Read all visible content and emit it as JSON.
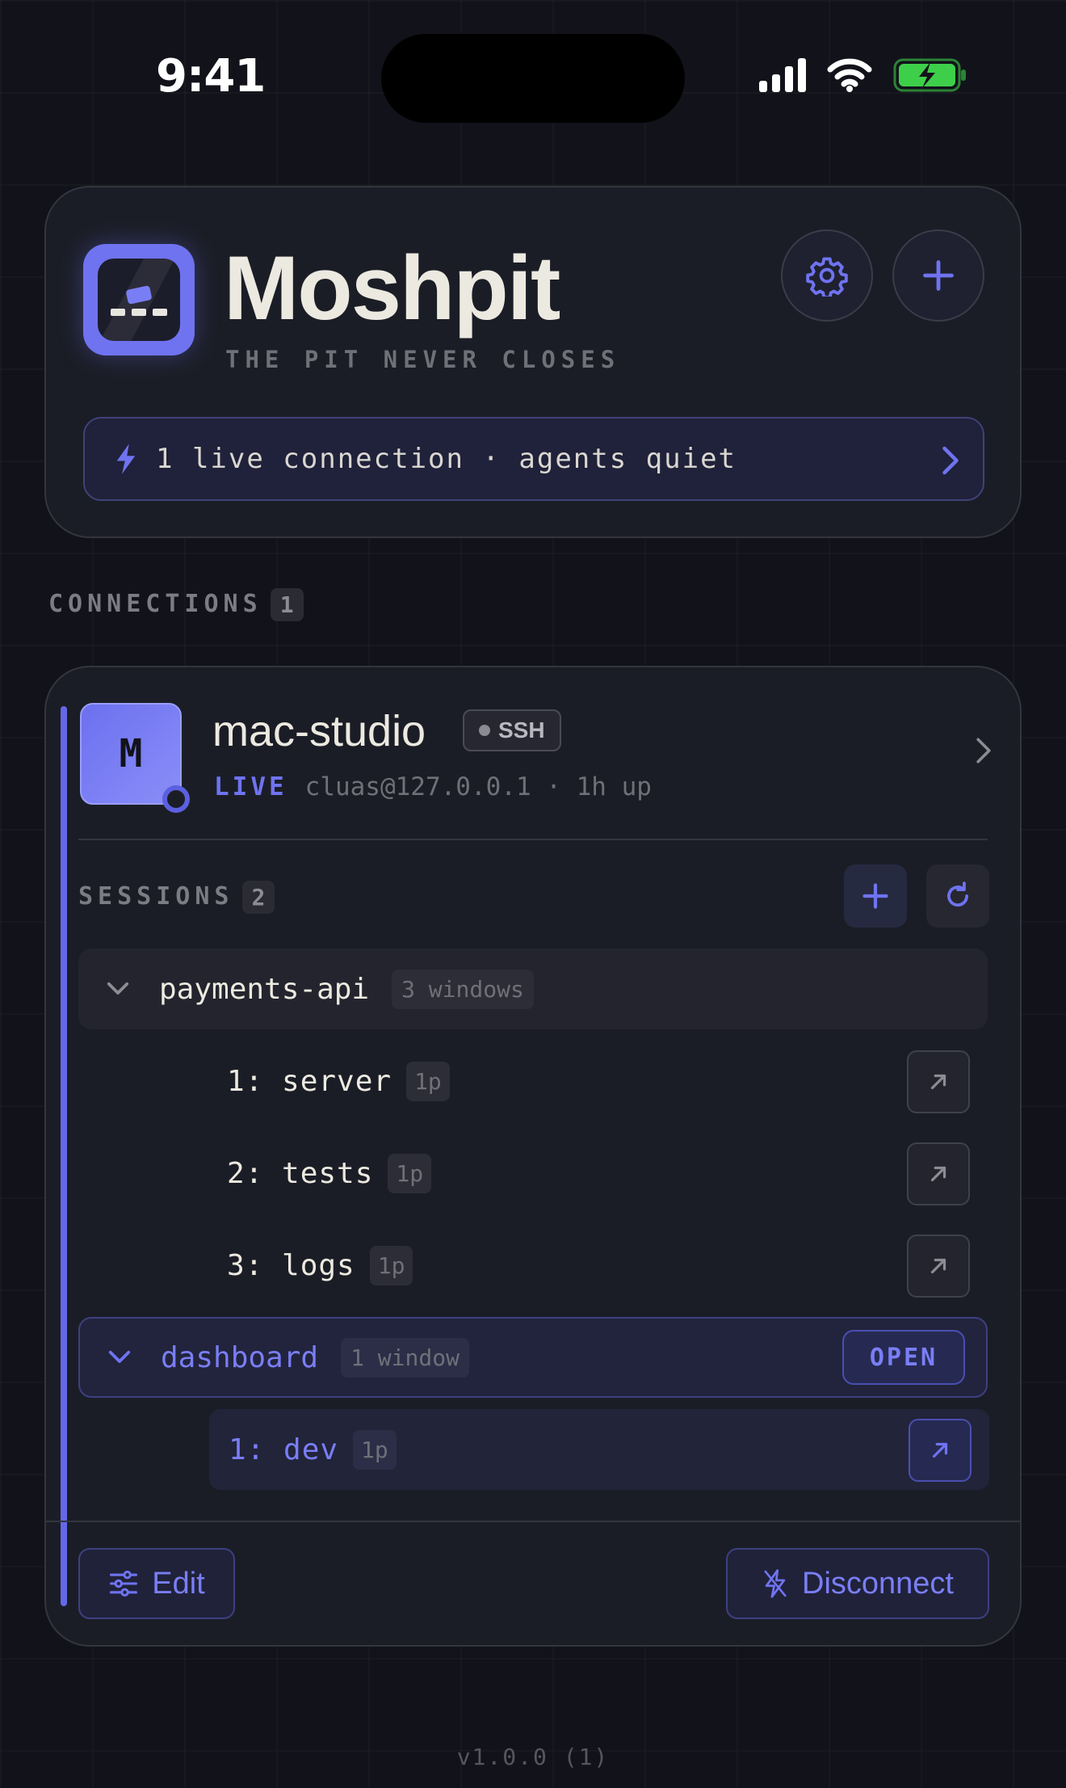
{
  "status_bar": {
    "time": "9:41"
  },
  "header": {
    "title": "Moshpit",
    "subtitle": "THE PIT NEVER CLOSES",
    "live_summary": "1 live connection · agents quiet"
  },
  "connections": {
    "label": "CONNECTIONS",
    "count": "1",
    "items": [
      {
        "avatar_letter": "M",
        "name": "mac-studio",
        "protocol": "SSH",
        "status": "LIVE",
        "address": "cluas@127.0.0.1 · 1h up",
        "sessions_label": "SESSIONS",
        "sessions_count": "2",
        "sessions": [
          {
            "name": "payments-api",
            "windows_label": "3 windows",
            "windows": [
              {
                "name": "1: server",
                "panes": "1p"
              },
              {
                "name": "2: tests",
                "panes": "1p"
              },
              {
                "name": "3: logs",
                "panes": "1p"
              }
            ]
          },
          {
            "name": "dashboard",
            "windows_label": "1 window",
            "open_label": "OPEN",
            "windows": [
              {
                "name": "1: dev",
                "panes": "1p"
              }
            ]
          }
        ],
        "edit_label": "Edit",
        "disconnect_label": "Disconnect"
      }
    ]
  },
  "version": "v1.0.0 (1)",
  "colors": {
    "accent": "#6f73f0",
    "background": "#12131a",
    "card": "#1b1d26",
    "battery": "#3ecf4a"
  }
}
